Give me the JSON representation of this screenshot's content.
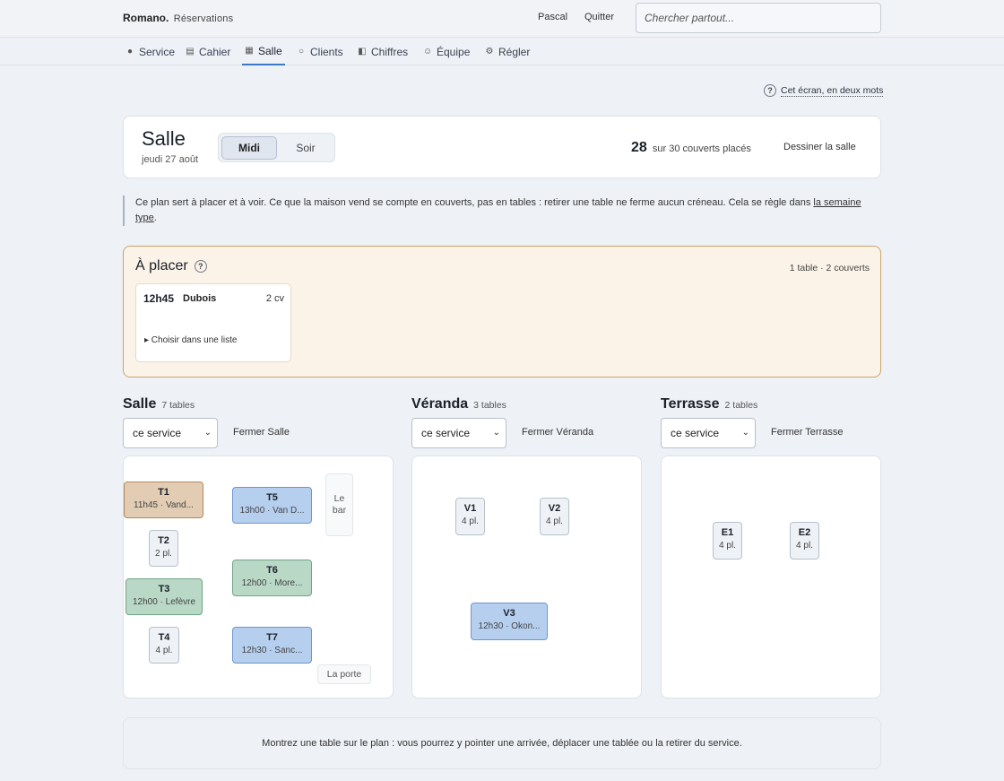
{
  "app": {
    "brand": "Romano.",
    "section": "Réservations"
  },
  "topbar": {
    "user": "Pascal",
    "quit": "Quitter",
    "search_placeholder": "Chercher partout..."
  },
  "nav": [
    {
      "label": "Service",
      "icon": "dot-icon"
    },
    {
      "label": "Cahier",
      "icon": "list-icon"
    },
    {
      "label": "Salle",
      "icon": "grid-icon",
      "active": true
    },
    {
      "label": "Clients",
      "icon": "circle-icon"
    },
    {
      "label": "Chiffres",
      "icon": "half-square-icon"
    },
    {
      "label": "Équipe",
      "icon": "smiley-icon"
    },
    {
      "label": "Régler",
      "icon": "gear-icon"
    }
  ],
  "help": {
    "label": "Cet écran, en deux mots"
  },
  "header": {
    "title": "Salle",
    "date": "jeudi 27 août",
    "services": [
      "Midi",
      "Soir"
    ],
    "selected_service": "Midi",
    "placed": "28",
    "placed_suffix": "sur 30 couverts placés",
    "draw_label": "Dessiner la salle"
  },
  "note": {
    "text": "Ce plan sert à placer et à voir. Ce que la maison vend se compte en couverts, pas en tables : retirer une table ne ferme aucun créneau. Cela se règle dans ",
    "link": "la semaine type",
    "end": "."
  },
  "to_place": {
    "title": "À placer",
    "count": "1 table · 2 couverts",
    "reservation": {
      "time": "12h45",
      "name": "Dubois",
      "covers": "2 cv",
      "choose": "▸ Choisir dans une liste"
    }
  },
  "zones": [
    {
      "name": "Salle",
      "count": "7 tables",
      "select": "ce service",
      "close": "Fermer Salle",
      "tables": [
        {
          "id": "T1",
          "sub": "11h45 · Vand...",
          "status": "orange"
        },
        {
          "id": "T2",
          "sub": "2 pl.",
          "status": "free"
        },
        {
          "id": "T3",
          "sub": "12h00 · Lefèvre",
          "status": "green"
        },
        {
          "id": "T4",
          "sub": "4 pl.",
          "status": "free"
        },
        {
          "id": "T5",
          "sub": "13h00 · Van D...",
          "status": "blue"
        },
        {
          "id": "T6",
          "sub": "12h00 · More...",
          "status": "green"
        },
        {
          "id": "T7",
          "sub": "12h30 · Sanc...",
          "status": "blue"
        }
      ],
      "fixtures": [
        "Le bar",
        "La porte"
      ]
    },
    {
      "name": "Véranda",
      "count": "3 tables",
      "select": "ce service",
      "close": "Fermer Véranda",
      "tables": [
        {
          "id": "V1",
          "sub": "4 pl.",
          "status": "free"
        },
        {
          "id": "V2",
          "sub": "4 pl.",
          "status": "free"
        },
        {
          "id": "V3",
          "sub": "12h30 · Okon...",
          "status": "blue"
        }
      ]
    },
    {
      "name": "Terrasse",
      "count": "2 tables",
      "select": "ce service",
      "close": "Fermer Terrasse",
      "tables": [
        {
          "id": "E1",
          "sub": "4 pl.",
          "status": "free"
        },
        {
          "id": "E2",
          "sub": "4 pl.",
          "status": "free"
        }
      ]
    }
  ],
  "footer_hint": "Montrez une table sur le plan : vous pourrez y pointer une arrivée, déplacer une tablée ou la retirer du service."
}
